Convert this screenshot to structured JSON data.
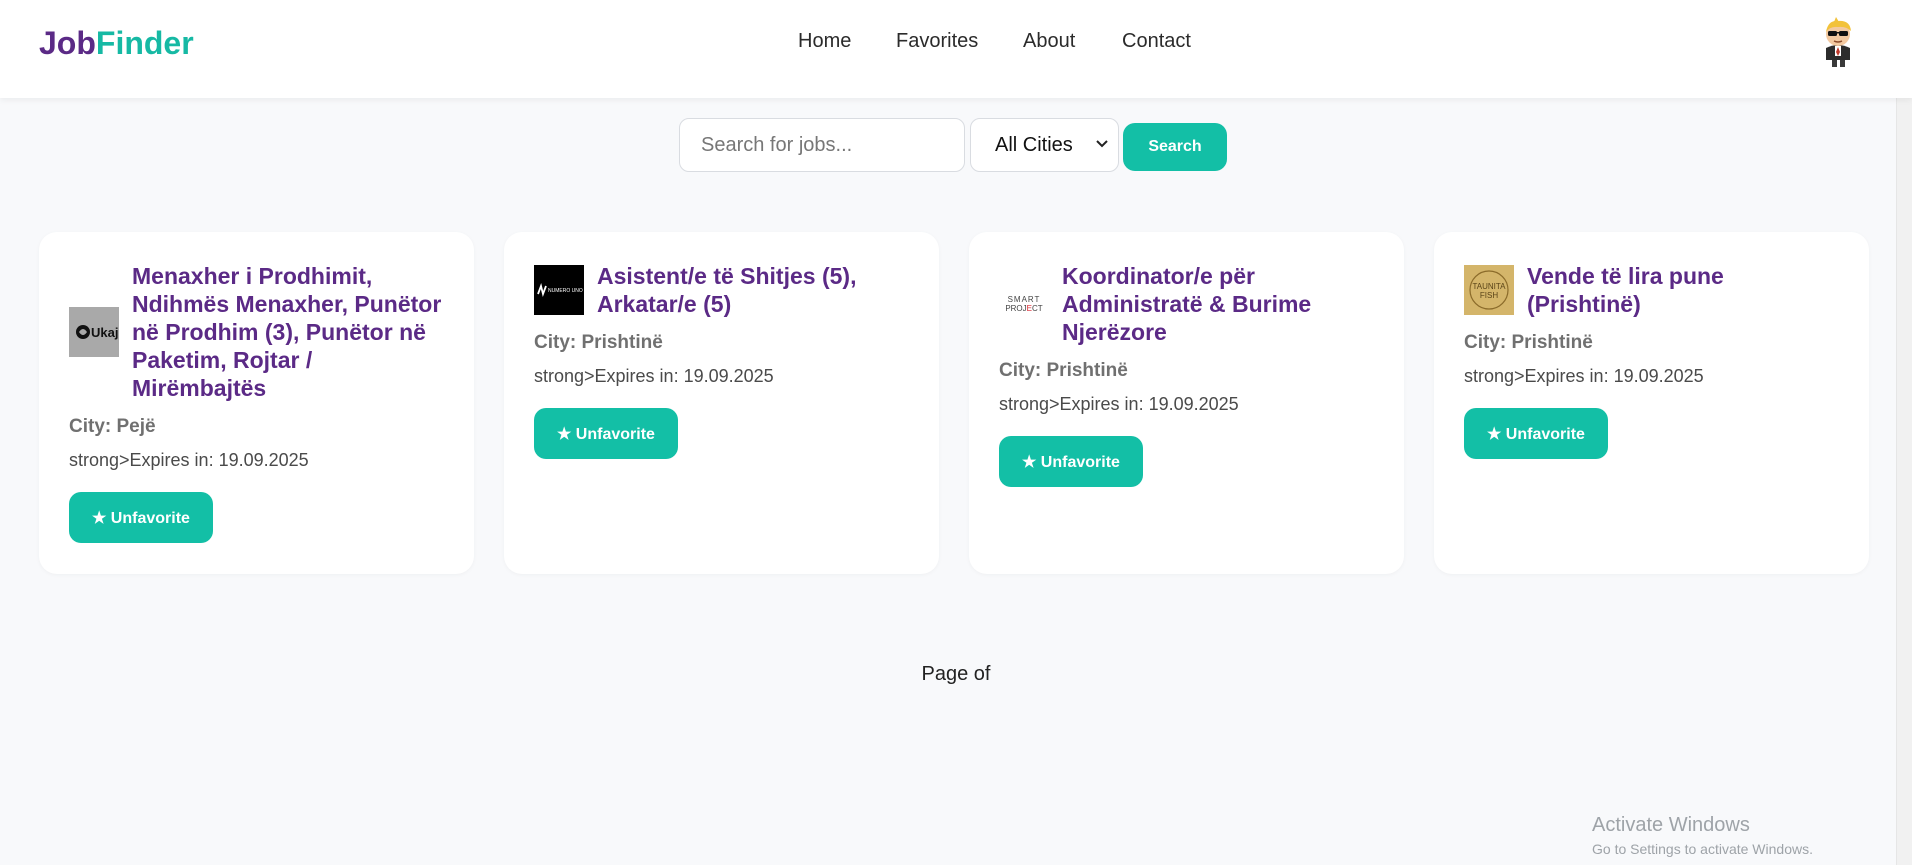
{
  "brand": {
    "part1": "Job",
    "part2": "Finder"
  },
  "nav": {
    "items": [
      {
        "label": "Home"
      },
      {
        "label": "Favorites"
      },
      {
        "label": "About"
      },
      {
        "label": "Contact"
      }
    ]
  },
  "search": {
    "placeholder": "Search for jobs...",
    "value": "",
    "city_selected": "All Cities",
    "button_label": "Search"
  },
  "cards": [
    {
      "logo_icon": "ukaj-logo",
      "logo_text": "Ukaj",
      "title": "Menaxher i Prodhimit, Ndihmës Menaxher, Punëtor në Prodhim (3), Punëtor në Paketim, Rojtar / Mirëmbajtës",
      "city": "City: Pejë",
      "expires": "strong>Expires in: 19.09.2025",
      "button_label": "★ Unfavorite"
    },
    {
      "logo_icon": "numero-uno-logo",
      "logo_text": "NUMERO UNO",
      "title": "Asistent/e të Shitjes (5), Arkatar/e (5)",
      "city": "City: Prishtinë",
      "expires": "strong>Expires in: 19.09.2025",
      "button_label": "★ Unfavorite"
    },
    {
      "logo_icon": "smart-project-logo",
      "logo_text": "SMART PROJECT",
      "title": "Koordinator/e për Administratë & Burime Njerëzore",
      "city": "City: Prishtinë",
      "expires": "strong>Expires in: 19.09.2025",
      "button_label": "★ Unfavorite"
    },
    {
      "logo_icon": "taunita-fish-logo",
      "logo_text": "TAUNITA FISH",
      "title": "Vende të lira pune (Prishtinë)",
      "city": "City: Prishtinë",
      "expires": "strong>Expires in: 19.09.2025",
      "button_label": "★ Unfavorite"
    }
  ],
  "pagination": {
    "text": "Page of"
  },
  "watermark": {
    "title": "Activate Windows",
    "subtitle": "Go to Settings to activate Windows."
  },
  "colors": {
    "brand_purple": "#5b2a86",
    "brand_teal": "#16b9a4",
    "button_teal": "#13bfa6",
    "background": "#f8f9fb"
  }
}
